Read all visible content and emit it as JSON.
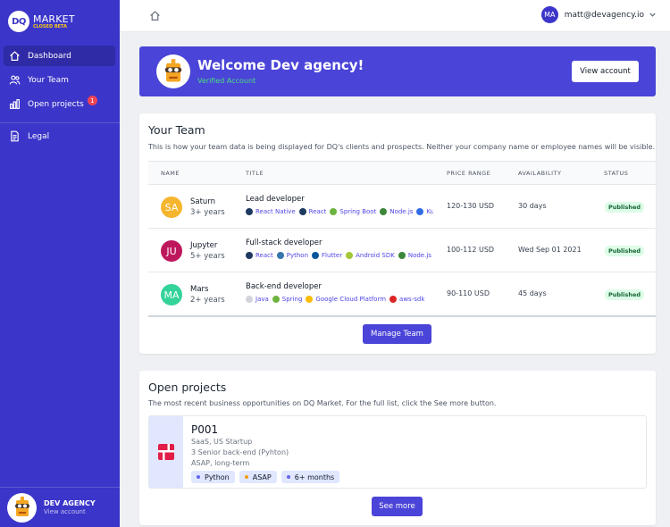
{
  "colors": {
    "sidebar": "#3b35c9",
    "accent": "#4a44d8",
    "verified": "#4ade80",
    "badge": "#ef4455"
  },
  "sidebar": {
    "logo_mark": "DQ",
    "logo_title": "MARKET",
    "logo_sub": "CLOSED BETA",
    "items": [
      {
        "label": "Dashboard",
        "icon": "home-icon"
      },
      {
        "label": "Your Team",
        "icon": "users-icon"
      },
      {
        "label": "Open projects",
        "icon": "chart-icon",
        "badge": "1"
      },
      {
        "label": "Legal",
        "icon": "document-icon"
      }
    ],
    "footer": {
      "name": "DEV AGENCY",
      "link": "View account"
    }
  },
  "topbar": {
    "user_initials": "MA",
    "user_email": "matt@devagency.io"
  },
  "welcome": {
    "title": "Welcome Dev agency!",
    "status": "Verified Account",
    "button": "View account"
  },
  "team": {
    "title": "Your Team",
    "description": "This is how your team data is being displayed for DQ's clients and prospects. Neither your company name or employee names will be visible.",
    "columns": [
      "NAME",
      "TITLE",
      "PRICE RANGE",
      "AVAILABILITY",
      "STATUS"
    ],
    "rows": [
      {
        "initials": "SA",
        "color": "#f5b52e",
        "name": "Saturn",
        "years": "3+ years",
        "title": "Lead developer",
        "tags": [
          {
            "t": "React Native",
            "c": "#1e3a5f"
          },
          {
            "t": "React",
            "c": "#1e3a5f"
          },
          {
            "t": "Spring Boot",
            "c": "#6db33f"
          },
          {
            "t": "Node.js",
            "c": "#3c873a"
          },
          {
            "t": "Ku",
            "c": "#326ce5"
          }
        ],
        "price": "120-130 USD",
        "availability": "30 days",
        "status": "Published"
      },
      {
        "initials": "JU",
        "color": "#be185d",
        "name": "Jupyter",
        "years": "5+ years",
        "title": "Full-stack developer",
        "tags": [
          {
            "t": "React",
            "c": "#1e3a5f"
          },
          {
            "t": "Python",
            "c": "#3776ab"
          },
          {
            "t": "Flutter",
            "c": "#02569b"
          },
          {
            "t": "Android SDK",
            "c": "#a4c639"
          },
          {
            "t": "Node.js",
            "c": "#3c873a"
          }
        ],
        "price": "100-112 USD",
        "availability": "Wed Sep 01 2021",
        "status": "Published"
      },
      {
        "initials": "MA",
        "color": "#34d399",
        "name": "Mars",
        "years": "2+ years",
        "title": "Back-end developer",
        "tags": [
          {
            "t": "Java",
            "c": "#d1d5db"
          },
          {
            "t": "Spring",
            "c": "#6db33f"
          },
          {
            "t": "Google Cloud Platform",
            "c": "#fbbc05"
          },
          {
            "t": "aws-sdk",
            "c": "#dc2626"
          }
        ],
        "price": "90-110 USD",
        "availability": "45 days",
        "status": "Published"
      }
    ],
    "button": "Manage Team"
  },
  "projects": {
    "title": "Open projects",
    "description": "The most recent business opportunities on DQ Market. For the full list, click the See more button.",
    "items": [
      {
        "id": "P001",
        "lines": [
          "SaaS, US Startup",
          "3 Senior back-end (Pyhton)",
          "ASAP, long-term"
        ],
        "chips": [
          {
            "t": "Python",
            "c": "#6366f1"
          },
          {
            "t": "ASAP",
            "c": "#f59e0b"
          },
          {
            "t": "6+ months",
            "c": "#6366f1"
          }
        ]
      }
    ],
    "button": "See more"
  }
}
